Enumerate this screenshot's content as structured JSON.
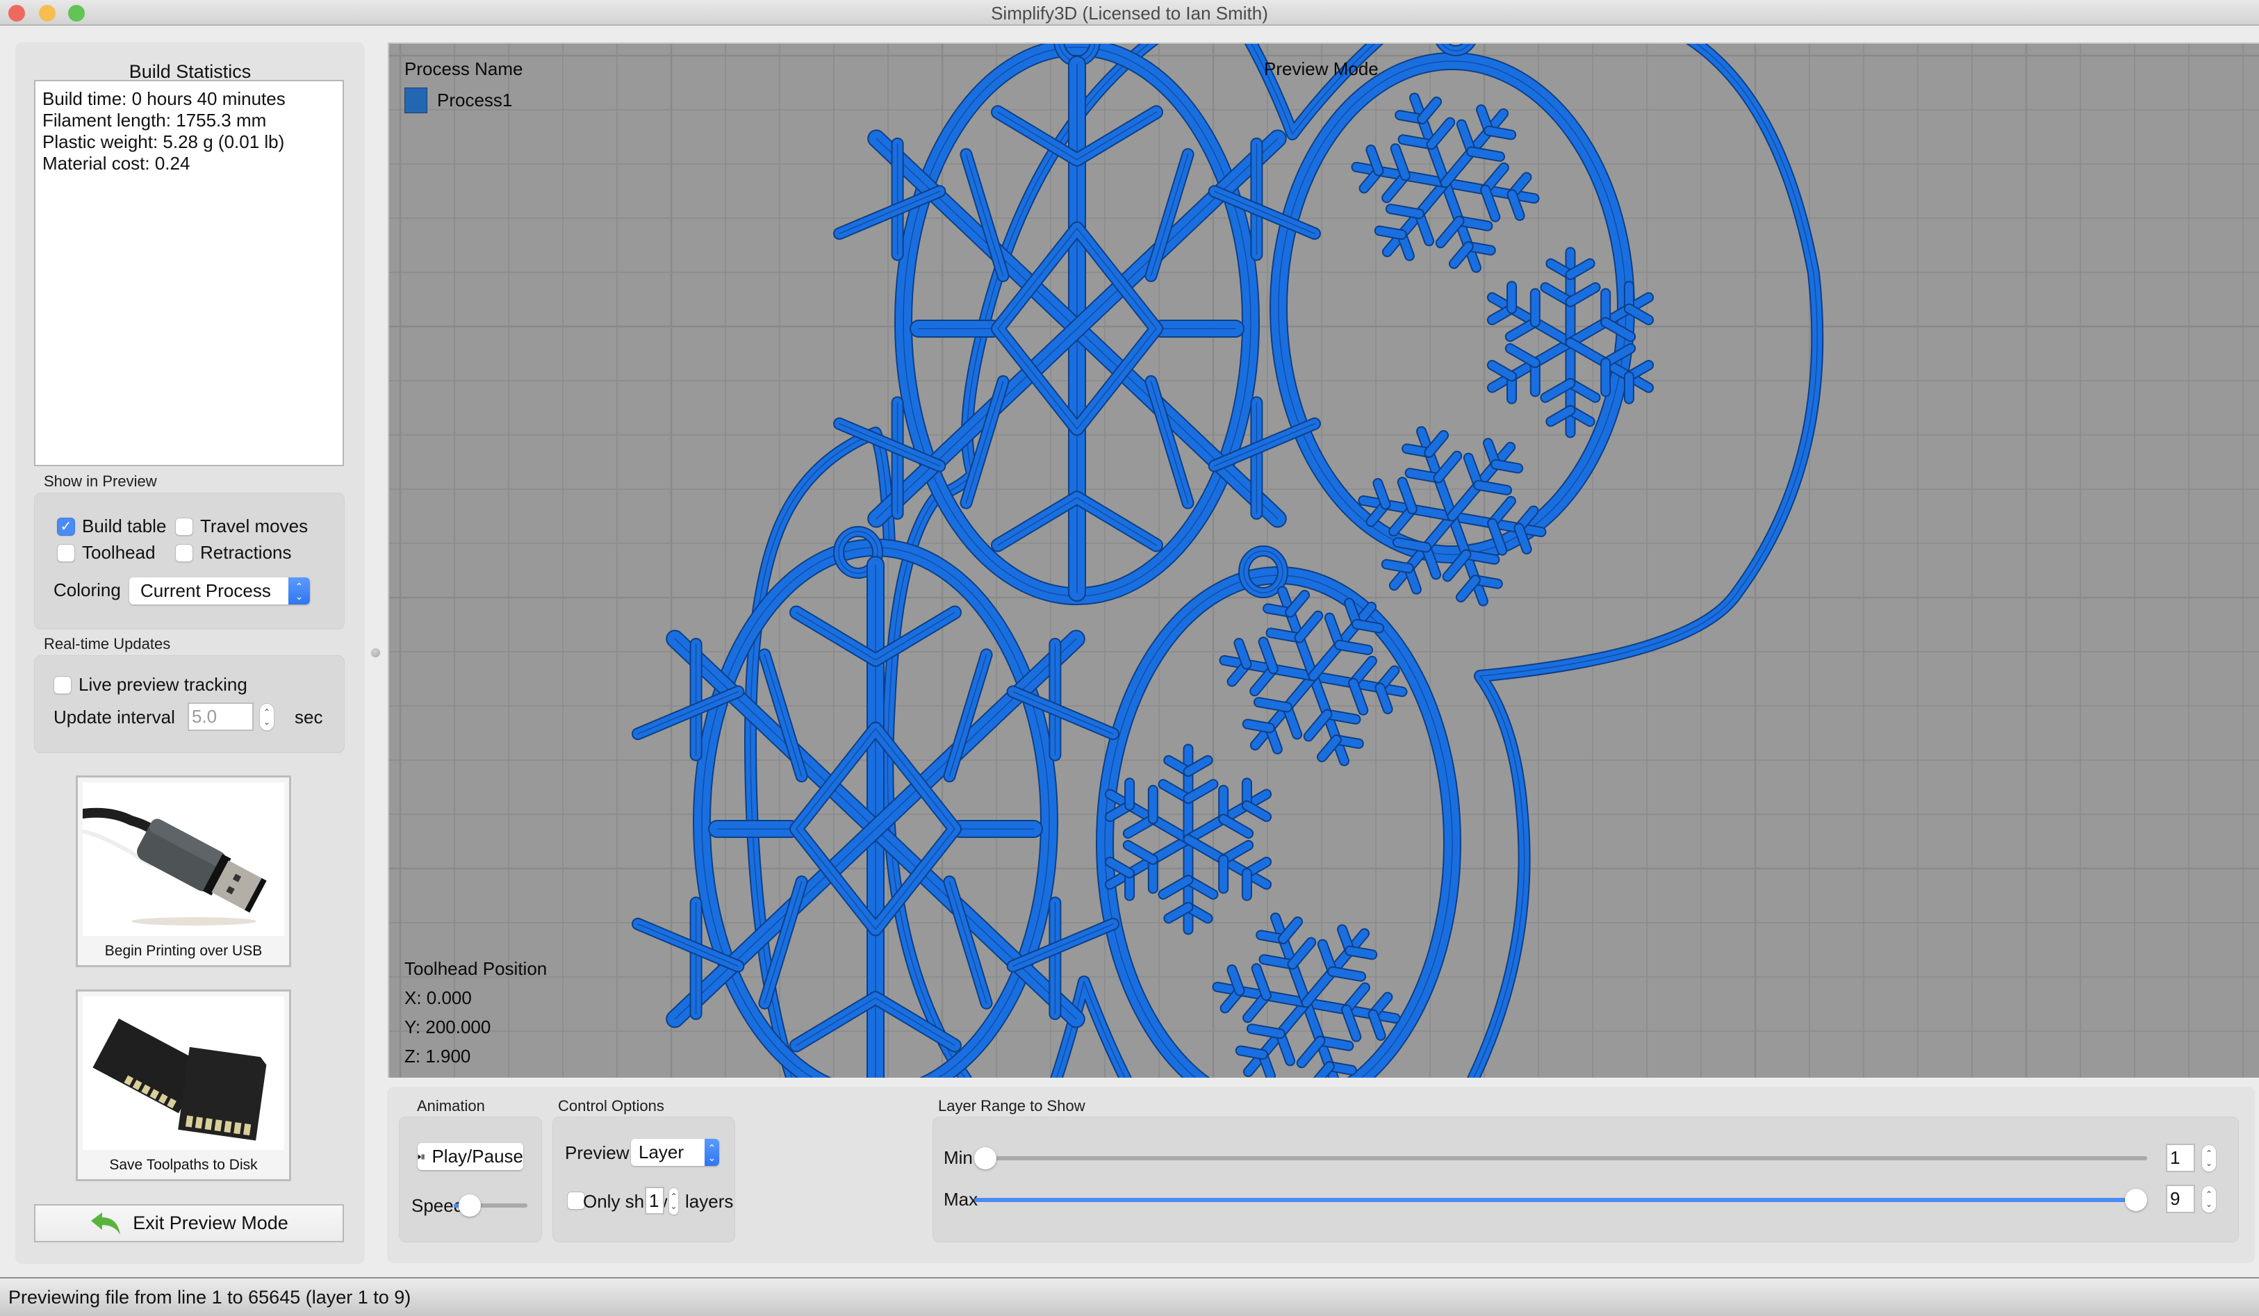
{
  "window": {
    "title": "Simplify3D (Licensed to Ian Smith)",
    "traffic_lights": {
      "close": "#ee6a5f",
      "minimize": "#f5be4f",
      "zoom": "#61c454"
    }
  },
  "build_statistics": {
    "title": "Build Statistics",
    "lines": [
      "Build time: 0 hours 40 minutes",
      "Filament length: 1755.3 mm",
      "Plastic weight: 5.28 g (0.01 lb)",
      "Material cost: 0.24"
    ]
  },
  "show_in_preview": {
    "label": "Show in Preview",
    "checkboxes": [
      {
        "label": "Build table",
        "checked": true
      },
      {
        "label": "Travel moves",
        "checked": false
      },
      {
        "label": "Toolhead",
        "checked": false
      },
      {
        "label": "Retractions",
        "checked": false
      }
    ],
    "coloring_label": "Coloring",
    "coloring_value": "Current Process"
  },
  "realtime_updates": {
    "label": "Real-time Updates",
    "live_tracking_label": "Live preview tracking",
    "live_tracking_checked": false,
    "interval_label": "Update interval",
    "interval_value": "5.0",
    "interval_unit": "sec"
  },
  "actions": {
    "usb_label": "Begin Printing over USB",
    "disk_label": "Save Toolpaths to Disk",
    "exit_label": "Exit Preview Mode",
    "check_glyph": "✓"
  },
  "viewport": {
    "process_header": "Process Name",
    "process_name": "Process1",
    "process_color": "#2367b2",
    "mode_label": "Preview Mode",
    "toolhead_header": "Toolhead Position",
    "toolhead_x": "X: 0.000",
    "toolhead_y": "Y: 200.000",
    "toolhead_z": "Z: 1.900",
    "toolpath_color": "#1a6fe0",
    "background_color": "#999999"
  },
  "animation": {
    "label": "Animation",
    "play_label": "Play/Pause",
    "speed_label": "Speed:",
    "speed_fraction": 0.1
  },
  "control_options": {
    "label": "Control Options",
    "preview_by_label": "Preview By",
    "preview_by_value": "Layer",
    "only_show_label": "Only show",
    "only_show_value": "1",
    "only_show_unit": "layers",
    "only_show_checked": false
  },
  "layer_range": {
    "label": "Layer Range to Show",
    "min_label": "Min",
    "max_label": "Max",
    "min_value": "1",
    "max_value": "9",
    "layer_min": 1,
    "layer_max": 9,
    "accent": "#4a8bf5"
  },
  "status": {
    "text": "Previewing file from line 1 to 65645 (layer 1 to 9)"
  }
}
